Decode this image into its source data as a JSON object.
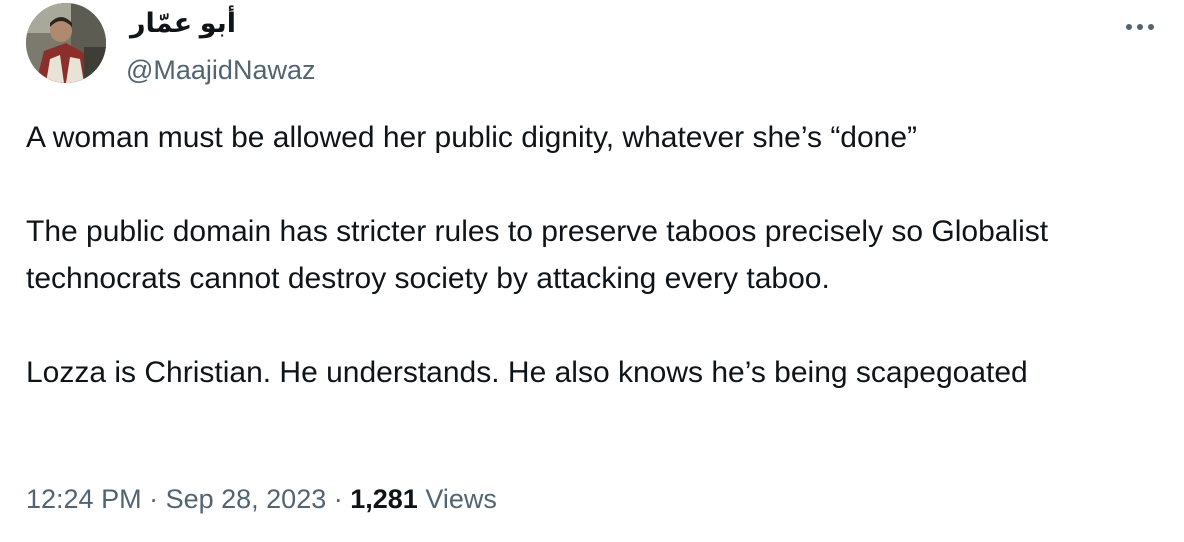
{
  "author": {
    "display_name": "أبو عمّار",
    "handle": "@MaajidNawaz",
    "avatar_icon": "profile-photo"
  },
  "more_icon": "more-dots-icon",
  "tweet": {
    "paragraphs": [
      "A woman must be allowed her public dignity, whatever she’s “done”",
      "The public domain has stricter rules to preserve taboos precisely so Globalist technocrats cannot destroy society by attacking every taboo.",
      "Lozza is Christian. He understands. He also knows he’s being scapegoated"
    ]
  },
  "meta": {
    "time": "12:24 PM",
    "separator": " · ",
    "date": "Sep 28, 2023",
    "views_count": "1,281",
    "views_label": "Views"
  },
  "colors": {
    "text": "#0f1419",
    "secondary": "#536471"
  }
}
